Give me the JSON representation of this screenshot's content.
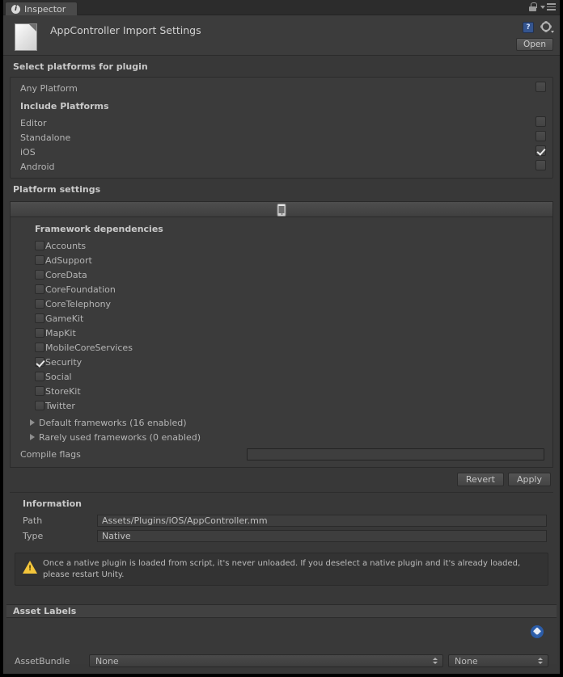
{
  "window": {
    "tab_label": "Inspector",
    "tab_icon": "info-circle-icon",
    "lock_icon": "lock-icon",
    "menu_icon": "hamburger-menu-icon"
  },
  "header": {
    "title": "AppController Import Settings",
    "file_icon": "file-document-icon",
    "help_icon": "help-book-icon",
    "help_glyph": "?",
    "settings_icon": "gear-icon",
    "open_label": "Open"
  },
  "platforms": {
    "section_title": "Select platforms for plugin",
    "any_platform": {
      "label": "Any Platform",
      "checked": false
    },
    "include_title": "Include Platforms",
    "items": [
      {
        "label": "Editor",
        "checked": false
      },
      {
        "label": "Standalone",
        "checked": false
      },
      {
        "label": "iOS",
        "checked": true
      },
      {
        "label": "Android",
        "checked": false
      }
    ]
  },
  "platform_settings": {
    "section_title": "Platform settings",
    "active_tab_icon": "iphone-device-icon",
    "frameworks_title": "Framework dependencies",
    "frameworks": [
      {
        "label": "Accounts",
        "checked": false
      },
      {
        "label": "AdSupport",
        "checked": false
      },
      {
        "label": "CoreData",
        "checked": false
      },
      {
        "label": "CoreFoundation",
        "checked": false
      },
      {
        "label": "CoreTelephony",
        "checked": false
      },
      {
        "label": "GameKit",
        "checked": false
      },
      {
        "label": "MapKit",
        "checked": false
      },
      {
        "label": "MobileCoreServices",
        "checked": false
      },
      {
        "label": "Security",
        "checked": true
      },
      {
        "label": "Social",
        "checked": false
      },
      {
        "label": "StoreKit",
        "checked": false
      },
      {
        "label": "Twitter",
        "checked": false
      }
    ],
    "foldouts": [
      {
        "label": "Default frameworks (16 enabled)",
        "expanded": false
      },
      {
        "label": "Rarely used frameworks (0 enabled)",
        "expanded": false
      }
    ],
    "compile_flags_label": "Compile flags",
    "compile_flags_value": ""
  },
  "actions": {
    "revert_label": "Revert",
    "apply_label": "Apply"
  },
  "information": {
    "section_title": "Information",
    "rows": [
      {
        "label": "Path",
        "value": "Assets/Plugins/iOS/AppController.mm"
      },
      {
        "label": "Type",
        "value": "Native"
      }
    ]
  },
  "warning": {
    "icon": "warning-triangle-icon",
    "text": "Once a native plugin is loaded from script, it's never unloaded. If you deselect a native plugin and it's already loaded, please restart Unity."
  },
  "asset_labels": {
    "section_title": "Asset Labels",
    "tag_icon": "label-tag-icon",
    "assetbundle_label": "AssetBundle",
    "assetbundle_value": "None",
    "variant_value": "None"
  },
  "colors": {
    "window_bg": "#383838",
    "panel_bg": "#3b3b3b",
    "accent_blue": "#2b5ca8",
    "warning_yellow": "#f3c53b",
    "text": "#b4b4b4"
  }
}
